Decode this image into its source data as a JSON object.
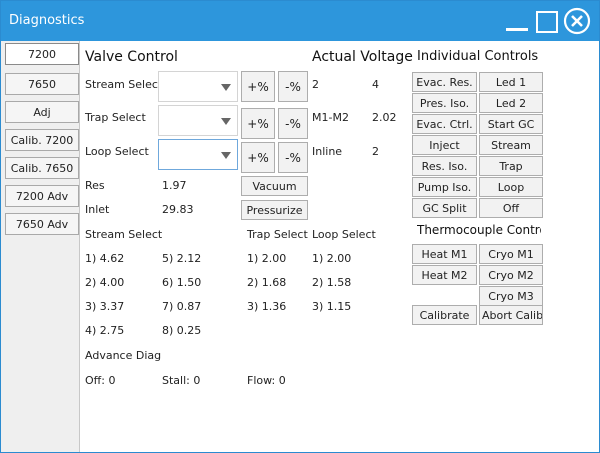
{
  "window": {
    "title": "Diagnostics"
  },
  "sidebar": {
    "tabs": [
      "7200",
      "7650",
      "Adj",
      "Calib. 7200",
      "Calib. 7650",
      "7200 Adv",
      "7650 Adv"
    ]
  },
  "valve_control": {
    "heading": "Valve Control",
    "stream_label": "Stream Select",
    "trap_label": "Trap Select",
    "loop_label": "Loop Select",
    "plus_label": "+%",
    "minus_label": "-%",
    "vacuum_label": "Vacuum",
    "pressurize_label": "Pressurize",
    "res_label": "Res",
    "res_value": "1.97",
    "inlet_label": "Inlet",
    "inlet_value": "29.83"
  },
  "actual_voltage": {
    "heading": "Actual Voltage",
    "rows": [
      {
        "label": "2",
        "value": "4"
      },
      {
        "label": "M1-M2",
        "value": "2.02"
      },
      {
        "label": "Inline",
        "value": "2"
      }
    ]
  },
  "individual_controls": {
    "heading": "Individual Controls",
    "buttons": [
      [
        "Evac. Res.",
        "Led 1"
      ],
      [
        "Pres. Iso.",
        "Led 2"
      ],
      [
        "Evac. Ctrl.",
        "Start GC"
      ],
      [
        "Inject",
        "Stream"
      ],
      [
        "Res. Iso.",
        "Trap"
      ],
      [
        "Pump Iso.",
        "Loop"
      ],
      [
        "GC Split",
        "Off"
      ]
    ]
  },
  "thermocouple": {
    "heading": "Thermocouple Control",
    "heat_m1": "Heat M1",
    "heat_m2": "Heat M2",
    "cryo_m1": "Cryo M1",
    "cryo_m2": "Cryo M2",
    "cryo_m3": "Cryo M3",
    "calibrate": "Calibrate",
    "abort_calibrate": "Abort Calibrate"
  },
  "stream_select": {
    "heading": "Stream Select",
    "col1": [
      "1) 4.62",
      "2) 4.00",
      "3) 3.37",
      "4) 2.75"
    ],
    "col2": [
      "5) 2.12",
      "6) 1.50",
      "7) 0.87",
      "8) 0.25"
    ]
  },
  "trap_select": {
    "heading": "Trap Select",
    "items": [
      "1) 2.00",
      "2) 1.68",
      "3) 1.36"
    ]
  },
  "loop_select": {
    "heading": "Loop Select",
    "items": [
      "1) 2.00",
      "2) 1.58",
      "3) 1.15"
    ]
  },
  "advance_diag": {
    "heading": "Advance Diag",
    "off": "Off: 0",
    "stall": "Stall: 0",
    "flow": "Flow: 0"
  },
  "colors": {
    "titlebar": "#2d96dc",
    "sidebar_bg": "#efefef",
    "button_bg": "#f2f2f2"
  }
}
